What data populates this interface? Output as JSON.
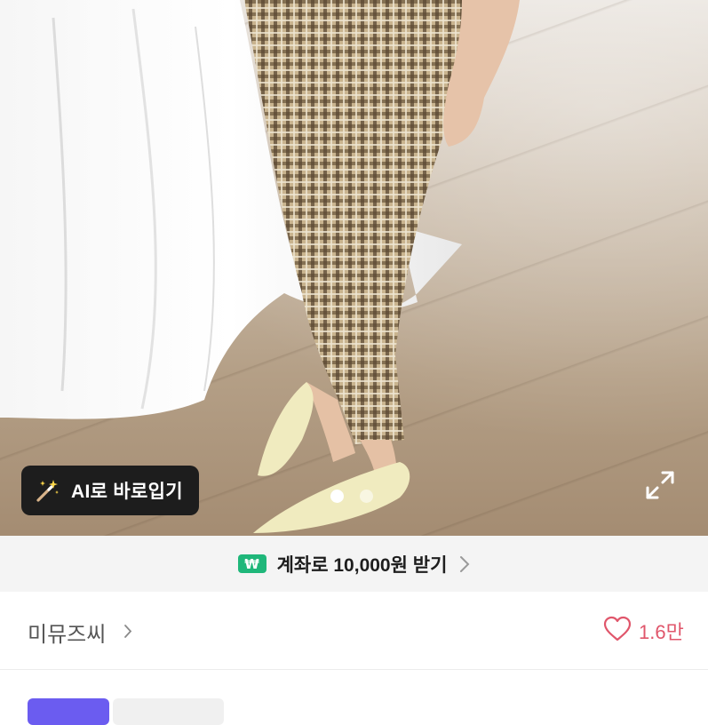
{
  "photo": {
    "ai_button": {
      "icon": "magic-wand-sparkle-icon",
      "label": "AI로 바로입기"
    },
    "carousel": {
      "total": 2,
      "active_index": 0
    },
    "expand_icon": "fullscreen-expand-icon"
  },
  "banner": {
    "badge_icon": "won-badge-icon",
    "badge_symbol": "₩",
    "text": "계좌로 10,000원 받기",
    "chevron_icon": "chevron-right-icon",
    "badge_color": "#1fb77a"
  },
  "seller": {
    "name": "미뮤즈씨",
    "chevron_icon": "chevron-right-icon"
  },
  "likes": {
    "icon": "heart-outline-icon",
    "count": "1.6만",
    "color": "#e0566b"
  },
  "tags": {
    "accent": "#6b5cf0"
  }
}
